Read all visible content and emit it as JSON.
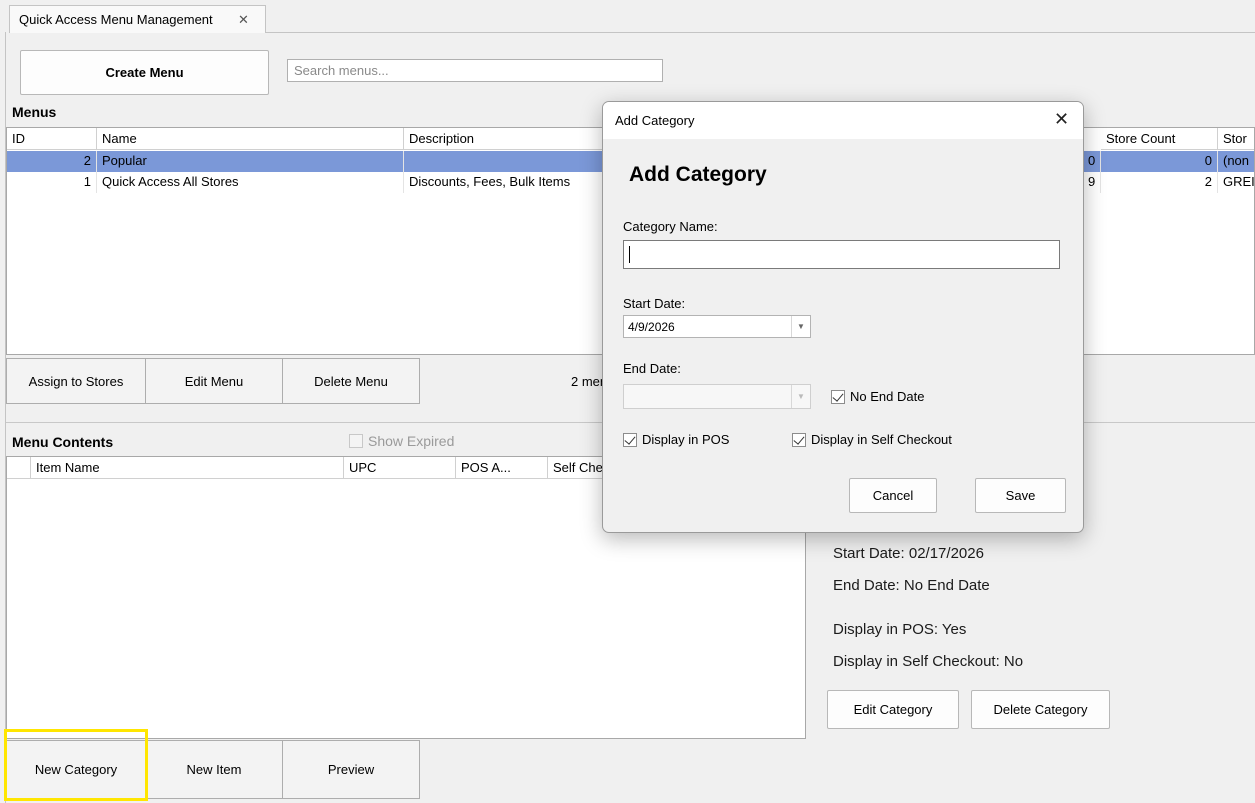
{
  "tab": {
    "title": "Quick Access Menu Management",
    "close": "✕"
  },
  "toolbar": {
    "create_menu": "Create Menu",
    "search_placeholder": "Search menus..."
  },
  "menus": {
    "title": "Menus",
    "columns": [
      "ID",
      "Name",
      "Description",
      "Store Count",
      "Stor"
    ],
    "rows": [
      {
        "id": "2",
        "name": "Popular",
        "desc": "",
        "col_hidden": "0",
        "store_count": "0",
        "store": "(non"
      },
      {
        "id": "1",
        "name": "Quick Access All Stores",
        "desc": "Discounts, Fees, Bulk Items",
        "col_hidden": "9",
        "store_count": "2",
        "store": "GREI"
      }
    ],
    "buttons": {
      "assign": "Assign to Stores",
      "edit": "Edit Menu",
      "delete": "Delete Menu"
    },
    "count_text": "2 men"
  },
  "contents": {
    "title": "Menu Contents",
    "show_expired": "Show Expired",
    "columns": [
      "Item Name",
      "UPC",
      "POS A...",
      "Self Che"
    ],
    "buttons": {
      "new_category": "New Category",
      "new_item": "New Item",
      "preview": "Preview"
    }
  },
  "details": {
    "start": "Start Date: 02/17/2026",
    "end": "End Date: No End Date",
    "pos": "Display in POS: Yes",
    "self_checkout": "Display in Self Checkout: No",
    "edit_category": "Edit Category",
    "delete_category": "Delete Category"
  },
  "dialog": {
    "window_title": "Add Category",
    "close": "✕",
    "heading": "Add Category",
    "category_name_label": "Category Name:",
    "category_name_value": "",
    "start_date_label": "Start Date:",
    "start_date_value": "4/9/2026",
    "end_date_label": "End Date:",
    "end_date_value": "",
    "no_end_date": "No End Date",
    "display_pos": "Display in POS",
    "display_self_checkout": "Display in Self Checkout",
    "cancel": "Cancel",
    "save": "Save"
  }
}
